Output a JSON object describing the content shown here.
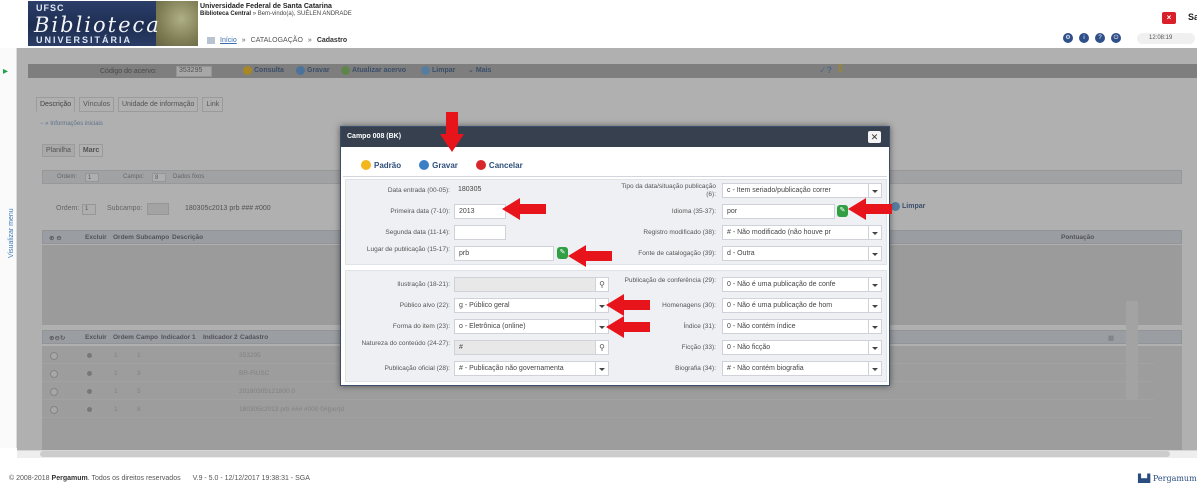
{
  "header": {
    "logo_top": "UFSC",
    "logo_main": "Biblioteca",
    "logo_bottom": "UNIVERSITÁRIA",
    "institution": "Universidade Federal de Santa Catarina",
    "unit": "Biblioteca Central",
    "welcome": "» Bem-vindo(a), SUÉLEN ANDRADE",
    "breadcrumb": {
      "home": "Início",
      "sep1": "»",
      "section": "CATALOGAÇÃO",
      "sep2": "»",
      "current": "Cadastro"
    },
    "exit_label": "Sa",
    "clock": "12:08:19"
  },
  "side": {
    "toggle_label": "Visualizar menu"
  },
  "toolbar": {
    "code_label": "Código do acervo:",
    "code_value": "353295",
    "consulta": "Consulta",
    "gravar": "Gravar",
    "atualizar": "Atualizar acervo",
    "limpar": "Limpar",
    "mais": "Mais",
    "help": "?"
  },
  "tabs": [
    "Descrição",
    "Vínculos",
    "Unidade de informação",
    "Link"
  ],
  "info_label": "Informações iniciais",
  "subtabs": [
    "Planilha",
    "Marc"
  ],
  "campo_row": {
    "ordem_label": "Ordem:",
    "ordem_value": "1",
    "campo_label": "Campo:",
    "campo_value": "8",
    "campo_desc": "Dados fixos"
  },
  "sub_row": {
    "ordem_label": "Ordem:",
    "ordem_value": "1",
    "subcampo_label": "Subcampo:",
    "value": "180305c2013  prb  ###  #000",
    "limpar": "Limpar"
  },
  "grid1": {
    "headers": [
      "Excluir",
      "Ordem",
      "Subcampo",
      "Descrição"
    ],
    "right_header": "Pontuação"
  },
  "grid2": {
    "headers": [
      "Excluir",
      "Ordem",
      "Campo",
      "Indicador 1",
      "Indicador 2",
      "Cadastro"
    ],
    "rows": [
      {
        "ordem": "1",
        "campo": "1",
        "cadastro": "353295"
      },
      {
        "ordem": "1",
        "campo": "3",
        "cadastro": "BR-FlUSC"
      },
      {
        "ordem": "1",
        "campo": "5",
        "cadastro": "20180305121800.0"
      },
      {
        "ordem": "1",
        "campo": "8",
        "cadastro": "180305c2013 prb ### #000 0#|por|d"
      }
    ]
  },
  "footer": {
    "copyright": "© 2008-2018",
    "brand": "Pergamum",
    "rights": ". Todos os direitos reservados",
    "version": "V.9 - 5.0 - 12/12/2017 19:38:31 - SGA",
    "brand_right": "Pergamum"
  },
  "modal": {
    "title": "Campo 008 (BK)",
    "close": "✕",
    "buttons": {
      "padrao": "Padrão",
      "gravar": "Gravar",
      "cancelar": "Cancelar"
    },
    "left": {
      "data_entrada": {
        "label": "Data entrada (00-05):",
        "value": "180305"
      },
      "primeira_data": {
        "label": "Primeira data (7-10):",
        "value": "2013"
      },
      "segunda_data": {
        "label": "Segunda data (11-14):",
        "value": ""
      },
      "lugar": {
        "label": "Lugar de publicação (15-17):",
        "value": "prb"
      },
      "ilustracao": {
        "label": "Ilustração (18-21):",
        "value": ""
      },
      "publico": {
        "label": "Público alvo (22):",
        "value": "g   - Público geral"
      },
      "forma": {
        "label": "Forma do item (23):",
        "value": "o   - Eletrônica (online)"
      },
      "natureza": {
        "label": "Natureza do conteúdo (24-27):",
        "value": "#"
      },
      "publicacao_oficial": {
        "label": "Publicação oficial (28):",
        "value": "#   - Publicação não governamenta"
      }
    },
    "right": {
      "tipo_data": {
        "label": "Tipo da data/situação publicação (6):",
        "value": "c   - Item seriado/publicação correr"
      },
      "idioma": {
        "label": "Idioma (35-37):",
        "value": "por"
      },
      "registro": {
        "label": "Registro modificado (38):",
        "value": "#   - Não modificado (não houve pr"
      },
      "fonte": {
        "label": "Fonte de catalogação (39):",
        "value": "d   - Outra"
      },
      "conferencia": {
        "label": "Publicação de conferência (29):",
        "value": "0   - Não é uma publicação de confe"
      },
      "homenagens": {
        "label": "Homenagens (30):",
        "value": "0   - Não é uma publicação de hom"
      },
      "indice": {
        "label": "Índice (31):",
        "value": "0   - Não contém índice"
      },
      "ficcao": {
        "label": "Ficção (33):",
        "value": "0   - Não ficção"
      },
      "biografia": {
        "label": "Biografia (34):",
        "value": "#   - Não contém biografia"
      }
    }
  },
  "colors": {
    "overlay": "#5a5a5a",
    "modal_title_bg": "#36404f",
    "arrow": "#e8141c",
    "accent": "#2f4f7a"
  }
}
